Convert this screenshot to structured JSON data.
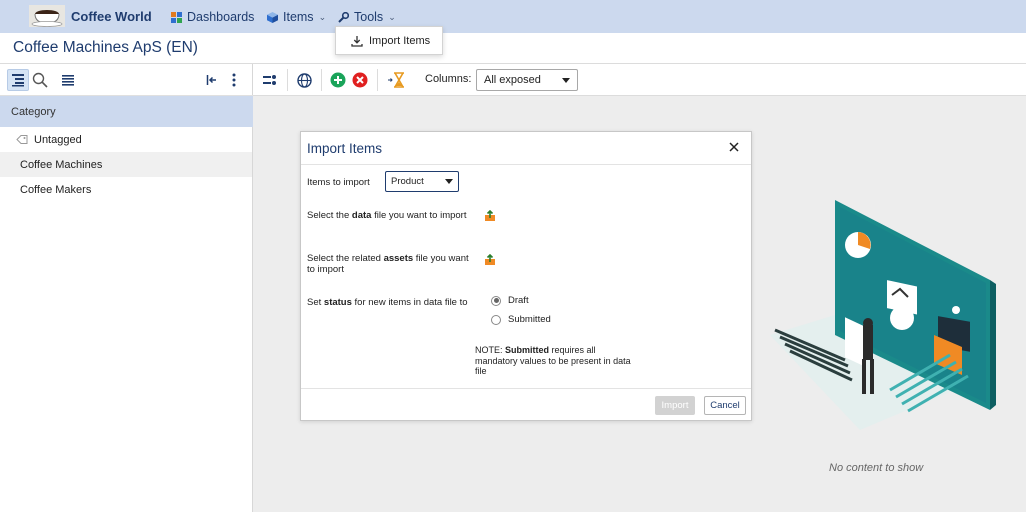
{
  "header": {
    "brand": "Coffee World",
    "nav": [
      {
        "label": "Dashboards",
        "icon": "dashboard-icon"
      },
      {
        "label": "Items",
        "icon": "cube-icon",
        "has_caret": true
      },
      {
        "label": "Tools",
        "icon": "wrench-icon",
        "has_caret": true
      }
    ],
    "tools_menu": {
      "items": [
        {
          "label": "Import Items",
          "icon": "download-icon"
        }
      ]
    }
  },
  "page": {
    "title": "Coffee Machines ApS (EN)"
  },
  "left_panel": {
    "toolbar_icons": [
      "tree-view-icon",
      "search-icon",
      "list-icon",
      "collapse-left-icon",
      "more-vertical-icon"
    ],
    "category_header": "Category",
    "tree": [
      {
        "label": "Untagged",
        "icon": "tag-icon",
        "selected": false
      },
      {
        "label": "Coffee Machines",
        "selected": true
      },
      {
        "label": "Coffee Makers",
        "selected": false
      }
    ]
  },
  "main_toolbar": {
    "icons": [
      "columns-config-icon",
      "globe-icon",
      "add-icon",
      "remove-icon",
      "hourglass-icon"
    ],
    "columns_label": "Columns:",
    "columns_value": "All exposed"
  },
  "main": {
    "empty_text": "No content to show"
  },
  "modal": {
    "title": "Import Items",
    "items_to_import_label": "Items to import",
    "items_to_import_value": "Product",
    "data_file": {
      "pre": "Select the ",
      "bold": "data",
      "post": " file you want to import"
    },
    "assets_file": {
      "pre": "Select the related ",
      "bold": "assets",
      "post": " file you want to import"
    },
    "status": {
      "pre": "Set ",
      "bold": "status",
      "post": " for new items in data file to"
    },
    "status_options": [
      {
        "label": "Draft",
        "selected": true
      },
      {
        "label": "Submitted",
        "selected": false
      }
    ],
    "note": {
      "pre": "NOTE: ",
      "bold": "Submitted",
      "post": " requires all mandatory values to be present in data file"
    },
    "import_button": "Import",
    "cancel_button": "Cancel"
  },
  "colors": {
    "nav_bg": "#ccd9ee",
    "brand_blue": "#1f3c6e",
    "add_green": "#1aa45a",
    "remove_red": "#e02020",
    "accent_orange": "#f08a24",
    "teal": "#1a8a8a"
  }
}
